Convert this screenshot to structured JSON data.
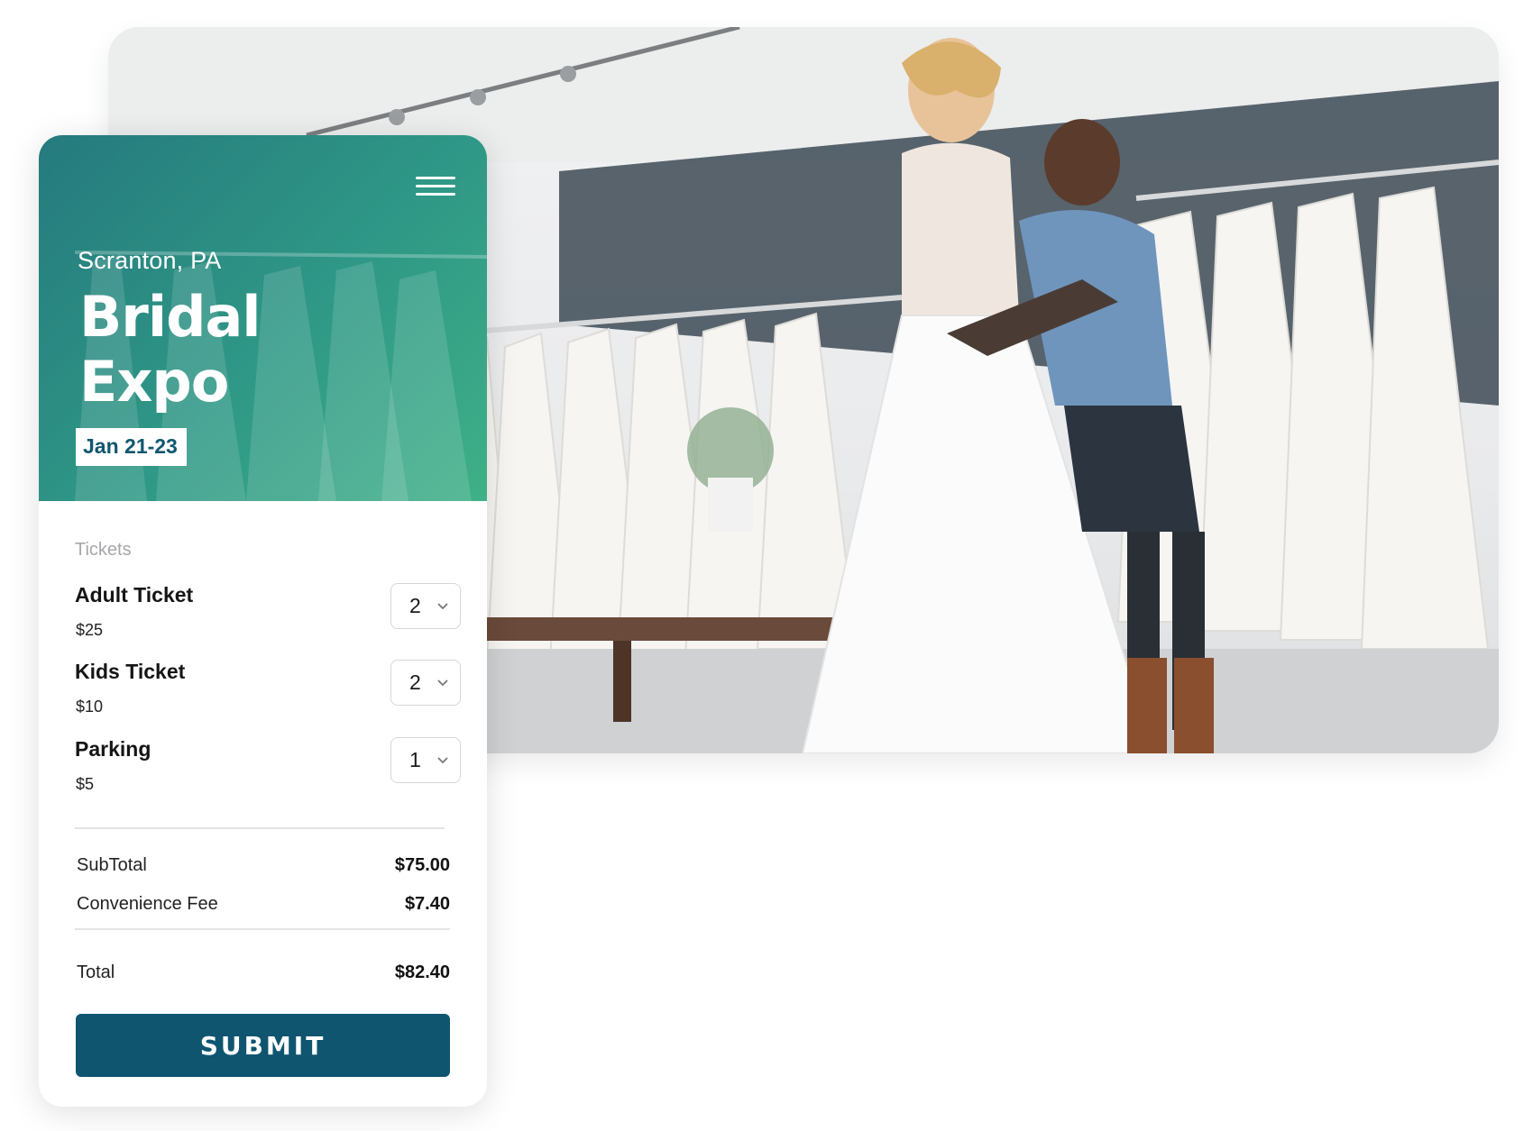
{
  "event": {
    "city": "Scranton, PA",
    "title_line1": "Bridal",
    "title_line2": "Expo",
    "dates": "Jan 21-23"
  },
  "tickets": {
    "section_label": "Tickets",
    "items": [
      {
        "name": "Adult Ticket",
        "price": "$25",
        "quantity": "2"
      },
      {
        "name": "Kids Ticket",
        "price": "$10",
        "quantity": "2"
      },
      {
        "name": "Parking",
        "price": "$5",
        "quantity": "1"
      }
    ]
  },
  "summary": {
    "subtotal_label": "SubTotal",
    "subtotal_value": "$75.00",
    "fee_label": "Convenience Fee",
    "fee_value": "$7.40",
    "total_label": "Total",
    "total_value": "$82.40"
  },
  "actions": {
    "submit_label": "SUBMIT"
  },
  "colors": {
    "hero_teal": "#2f9886",
    "accent_navy": "#0f5570"
  },
  "icons": {
    "menu": "hamburger-menu-icon",
    "dropdown": "chevron-down-icon"
  }
}
